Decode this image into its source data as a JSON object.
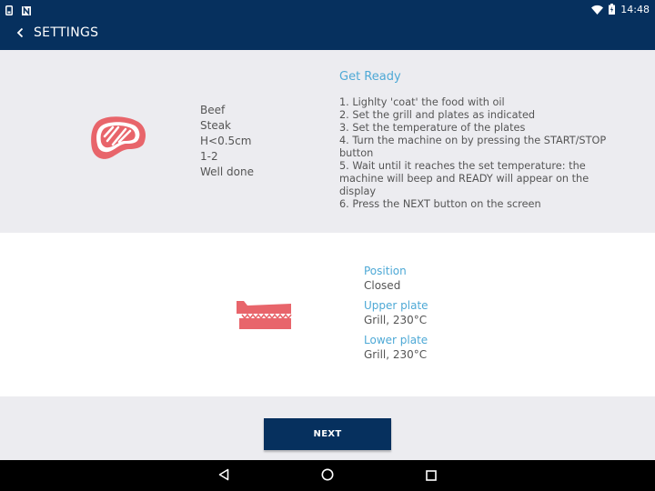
{
  "status_bar": {
    "time": "14:48"
  },
  "app_bar": {
    "title": "SETTINGS"
  },
  "food": {
    "lines": [
      "Beef",
      "Steak",
      "H<0.5cm",
      "1-2",
      "Well done"
    ]
  },
  "get_ready": {
    "title": "Get Ready",
    "steps": [
      "1. Lighlty 'coat' the food with oil",
      "2. Set the grill and plates as indicated",
      "3. Set the temperature of the plates",
      "4. Turn the machine on by pressing the START/STOP button",
      "5. Wait until it reaches the set temperature: the machine will beep and READY will appear on the display",
      "6. Press the NEXT button on the screen"
    ]
  },
  "plates": {
    "position_label": "Position",
    "position_value": "Closed",
    "upper_label": "Upper plate",
    "upper_value": "Grill, 230°C",
    "lower_label": "Lower plate",
    "lower_value": "Grill, 230°C"
  },
  "next_button": {
    "label": "NEXT"
  },
  "colors": {
    "primary": "#06305e",
    "accent": "#4ea9d6",
    "icon": "#e8656b",
    "text": "#555555",
    "background": "#ececf0"
  },
  "icons": {
    "status_left": [
      "sim-card-icon",
      "notification-n-icon"
    ],
    "status_right": [
      "wifi-icon",
      "battery-charging-icon"
    ],
    "back": "chevron-left-icon",
    "food": "steak-icon",
    "grill": "grill-closed-icon",
    "nav": [
      "back-triangle-icon",
      "home-circle-icon",
      "recents-square-icon"
    ]
  }
}
